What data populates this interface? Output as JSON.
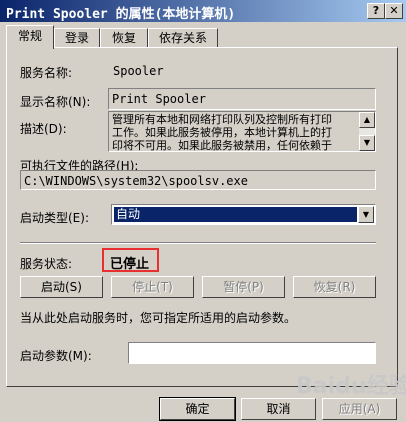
{
  "window": {
    "title": "Print Spooler 的属性(本地计算机)",
    "help_icon": "?",
    "close_icon": "✕"
  },
  "tabs": [
    {
      "label": "常规",
      "active": true
    },
    {
      "label": "登录",
      "active": false
    },
    {
      "label": "恢复",
      "active": false
    },
    {
      "label": "依存关系",
      "active": false
    }
  ],
  "general": {
    "service_name_label": "服务名称:",
    "service_name_value": "Spooler",
    "display_name_label": "显示名称(N):",
    "display_name_value": "Print Spooler",
    "description_label": "描述(D):",
    "description_lines": [
      "管理所有本地和网络打印队列及控制所有打印",
      "工作。如果此服务被停用，本地计算机上的打",
      "印将不可用。如果此服务被禁用，任何依赖于"
    ],
    "exe_path_label": "可执行文件的路径(H):",
    "exe_path_value": "C:\\WINDOWS\\system32\\spoolsv.exe",
    "startup_type_label": "启动类型(E):",
    "startup_type_value": "自动",
    "service_status_label": "服务状态:",
    "service_status_value": "已停止",
    "start_button": "启动(S)",
    "stop_button": "停止(T)",
    "pause_button": "暂停(P)",
    "resume_button": "恢复(R)",
    "hint_text": "当从此处启动服务时，您可指定所适用的启动参数。",
    "start_params_label": "启动参数(M):",
    "start_params_value": ""
  },
  "footer": {
    "ok_button": "确定",
    "cancel_button": "取消",
    "apply_button": "应用(A)"
  },
  "watermark": "Baidu经验"
}
